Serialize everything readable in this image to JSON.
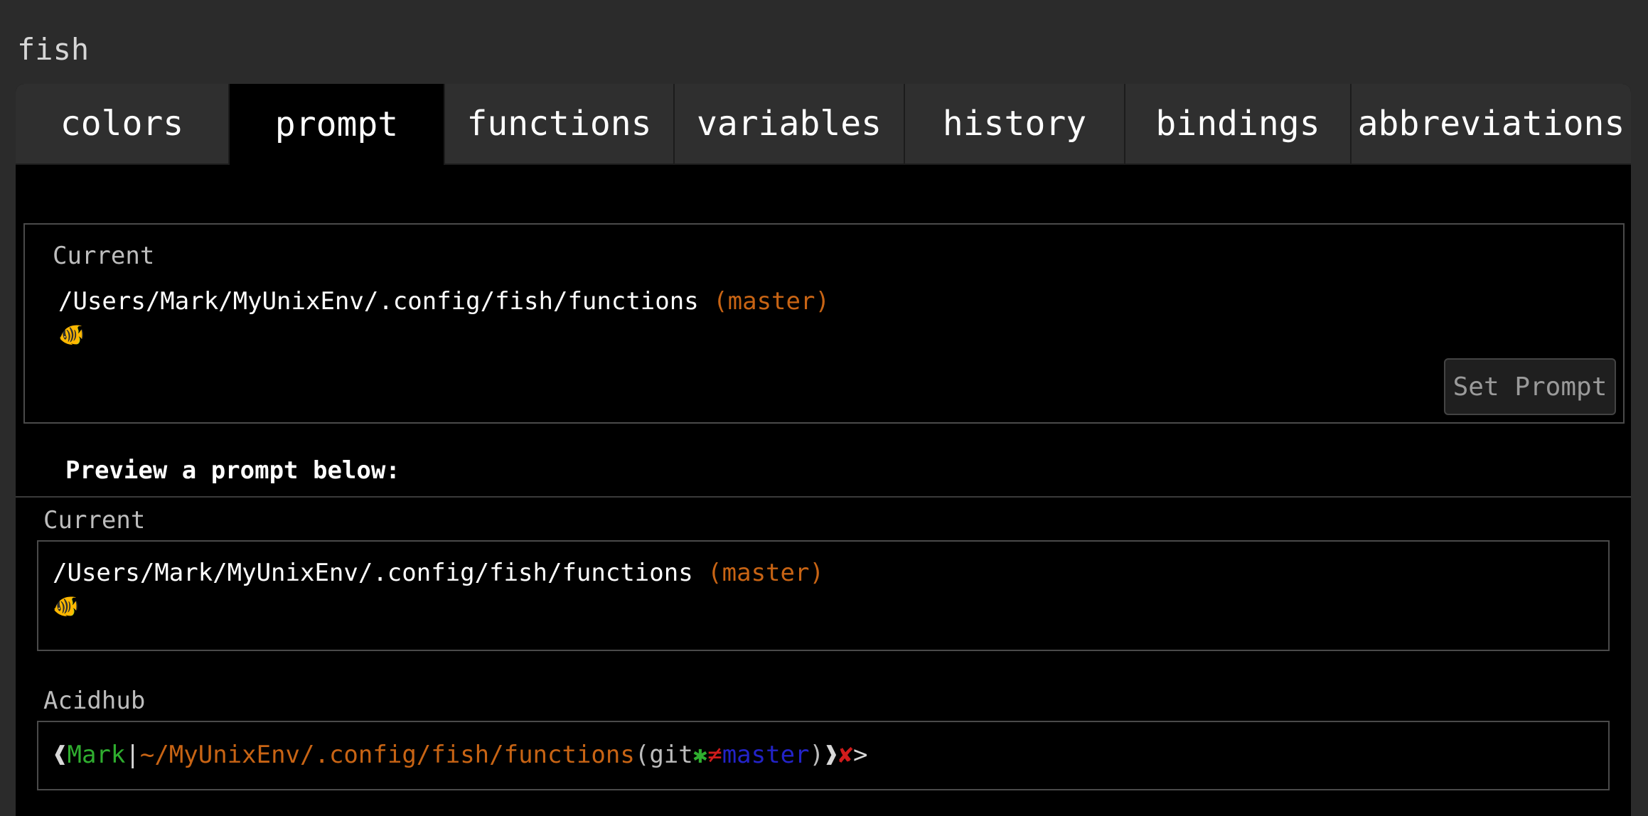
{
  "app": {
    "title": "fish"
  },
  "tabs": [
    {
      "label": "colors",
      "active": false
    },
    {
      "label": "prompt",
      "active": true
    },
    {
      "label": "functions",
      "active": false
    },
    {
      "label": "variables",
      "active": false
    },
    {
      "label": "history",
      "active": false
    },
    {
      "label": "bindings",
      "active": false
    },
    {
      "label": "abbreviations",
      "active": false
    }
  ],
  "current": {
    "label": "Current",
    "path": "/Users/Mark/MyUnixEnv/.config/fish/functions",
    "branch": "(master)",
    "fish_glyph": "🐠",
    "set_prompt_label": "Set Prompt"
  },
  "preview": {
    "heading": "Preview a prompt below:",
    "samples": [
      {
        "label": "Current",
        "path": "/Users/Mark/MyUnixEnv/.config/fish/functions",
        "branch": "(master)",
        "fish_glyph": "🐠"
      },
      {
        "label": "Acidhub",
        "parts": {
          "open": "❰",
          "user": "Mark",
          "sep": "|",
          "cwd": "~/MyUnixEnv/.config/fish/functions",
          "git_open": "(git",
          "star": "✱",
          "neq": "≠",
          "branch": "master",
          "git_close": ")",
          "close": "❱",
          "x": "✘",
          "gt": ">"
        }
      }
    ]
  },
  "colors": {
    "branch": "#c86414",
    "user": "#2fae2f",
    "branch_blue": "#2323c8",
    "error_red": "#d01c1c"
  }
}
